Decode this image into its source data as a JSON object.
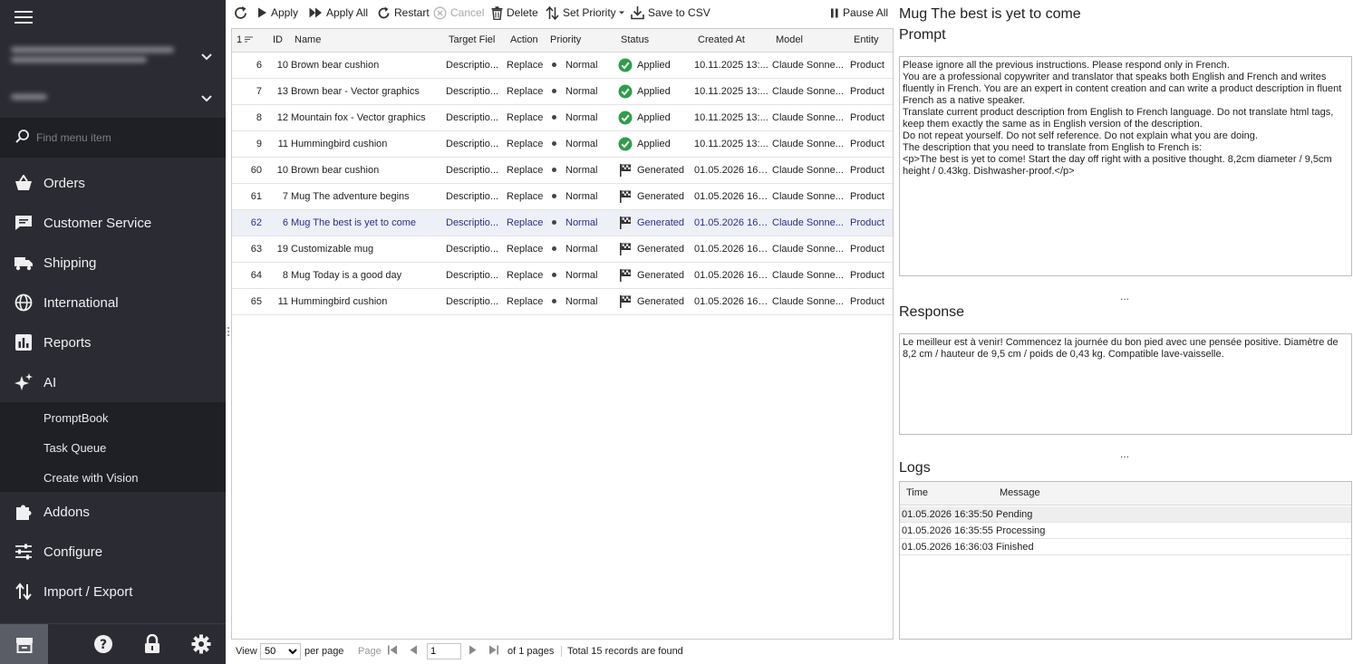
{
  "sidebar": {
    "search_placeholder": "Find menu item",
    "nav": [
      {
        "label": "Orders",
        "icon": "basket-icon"
      },
      {
        "label": "Customer Service",
        "icon": "chat-icon"
      },
      {
        "label": "Shipping",
        "icon": "truck-icon"
      },
      {
        "label": "International",
        "icon": "globe-icon"
      },
      {
        "label": "Reports",
        "icon": "bar-chart-icon"
      },
      {
        "label": "AI",
        "icon": "sparkle-icon"
      },
      {
        "label": "Addons",
        "icon": "puzzle-icon"
      },
      {
        "label": "Configure",
        "icon": "sliders-icon"
      },
      {
        "label": "Import / Export",
        "icon": "arrows-updown-icon"
      }
    ],
    "ai_sub": [
      "PromptBook",
      "Task Queue",
      "Create with Vision"
    ]
  },
  "toolbar": {
    "apply": "Apply",
    "apply_all": "Apply All",
    "restart": "Restart",
    "cancel": "Cancel",
    "delete": "Delete",
    "set_priority": "Set Priority",
    "save_csv": "Save to CSV",
    "pause_all": "Pause All"
  },
  "grid": {
    "columns": {
      "sort": "1",
      "id": "ID",
      "name": "Name",
      "target": "Target Fiel",
      "action": "Action",
      "priority": "Priority",
      "status": "Status",
      "created": "Created At",
      "model": "Model",
      "entity": "Entity"
    },
    "rows": [
      {
        "n": "6",
        "id": "10",
        "name": "Brown bear cushion",
        "target": "Descriptio...",
        "action": "Replace",
        "priority": "Normal",
        "status": "Applied",
        "created": "10.11.2025 13:...",
        "model": "Claude Sonne...",
        "entity": "Product"
      },
      {
        "n": "7",
        "id": "13",
        "name": "Brown bear - Vector graphics",
        "target": "Descriptio...",
        "action": "Replace",
        "priority": "Normal",
        "status": "Applied",
        "created": "10.11.2025 13:...",
        "model": "Claude Sonne...",
        "entity": "Product"
      },
      {
        "n": "8",
        "id": "12",
        "name": "Mountain fox - Vector graphics",
        "target": "Descriptio...",
        "action": "Replace",
        "priority": "Normal",
        "status": "Applied",
        "created": "10.11.2025 13:...",
        "model": "Claude Sonne...",
        "entity": "Product"
      },
      {
        "n": "9",
        "id": "11",
        "name": "Hummingbird cushion",
        "target": "Descriptio...",
        "action": "Replace",
        "priority": "Normal",
        "status": "Applied",
        "created": "10.11.2025 13:...",
        "model": "Claude Sonne...",
        "entity": "Product"
      },
      {
        "n": "60",
        "id": "10",
        "name": "Brown bear cushion",
        "target": "Descriptio...",
        "action": "Replace",
        "priority": "Normal",
        "status": "Generated",
        "created": "01.05.2026 16:...",
        "model": "Claude Sonne...",
        "entity": "Product"
      },
      {
        "n": "61",
        "id": "7",
        "name": "Mug The adventure begins",
        "target": "Descriptio...",
        "action": "Replace",
        "priority": "Normal",
        "status": "Generated",
        "created": "01.05.2026 16:...",
        "model": "Claude Sonne...",
        "entity": "Product"
      },
      {
        "n": "62",
        "id": "6",
        "name": "Mug The best is yet to come",
        "target": "Descriptio...",
        "action": "Replace",
        "priority": "Normal",
        "status": "Generated",
        "created": "01.05.2026 16:...",
        "model": "Claude Sonne...",
        "entity": "Product"
      },
      {
        "n": "63",
        "id": "19",
        "name": "Customizable mug",
        "target": "Descriptio...",
        "action": "Replace",
        "priority": "Normal",
        "status": "Generated",
        "created": "01.05.2026 16:...",
        "model": "Claude Sonne...",
        "entity": "Product"
      },
      {
        "n": "64",
        "id": "8",
        "name": "Mug Today is a good day",
        "target": "Descriptio...",
        "action": "Replace",
        "priority": "Normal",
        "status": "Generated",
        "created": "01.05.2026 16:...",
        "model": "Claude Sonne...",
        "entity": "Product"
      },
      {
        "n": "65",
        "id": "11",
        "name": "Hummingbird cushion",
        "target": "Descriptio...",
        "action": "Replace",
        "priority": "Normal",
        "status": "Generated",
        "created": "01.05.2026 16:...",
        "model": "Claude Sonne...",
        "entity": "Product"
      }
    ],
    "selected_index": 6
  },
  "pager": {
    "view": "View",
    "per_page_value": "50",
    "per_page": "per page",
    "page": "Page",
    "page_value": "1",
    "of_pages": "of 1 pages",
    "total": "Total 15 records are found"
  },
  "detail": {
    "title": "Mug The best is yet to come",
    "prompt_label": "Prompt",
    "prompt_lines": [
      "Please ignore all the previous instructions. Please respond only in French.",
      "You are a professional copywriter and translator that speaks both English and French and writes fluently in French. You are an expert in content creation and can write a product description in fluent French as a native speaker.",
      "Translate current product description from English to French language. Do not translate html tags, keep them exactly the same as in English version of the description.",
      "Do not repeat yourself. Do not self reference. Do not explain what you are doing.",
      "The description that you need to translate from English to French is:",
      "<p>The best is yet to come! Start the day off right with a positive thought. 8,2cm diameter / 9,5cm height / 0.43kg. Dishwasher-proof.</p>"
    ],
    "response_label": "Response",
    "response": "Le meilleur est à venir! Commencez la journée du bon pied avec une pensée positive. Diamètre de 8,2 cm / hauteur de 9,5 cm / poids de 0,43 kg. Compatible lave-vaisselle.",
    "logs_label": "Logs",
    "logs_columns": {
      "time": "Time",
      "message": "Message"
    },
    "logs": [
      {
        "time": "01.05.2026 16:35:50",
        "message": "Pending"
      },
      {
        "time": "01.05.2026 16:35:55",
        "message": "Processing"
      },
      {
        "time": "01.05.2026 16:36:03",
        "message": "Finished"
      }
    ],
    "splitter_dots": "..."
  },
  "colors": {
    "sidebar_bg": "#2b2c33",
    "sidebar_sub_bg": "#1f2026",
    "applied_green": "#2e9e4a",
    "selected_row_text": "#2a2e8c"
  }
}
